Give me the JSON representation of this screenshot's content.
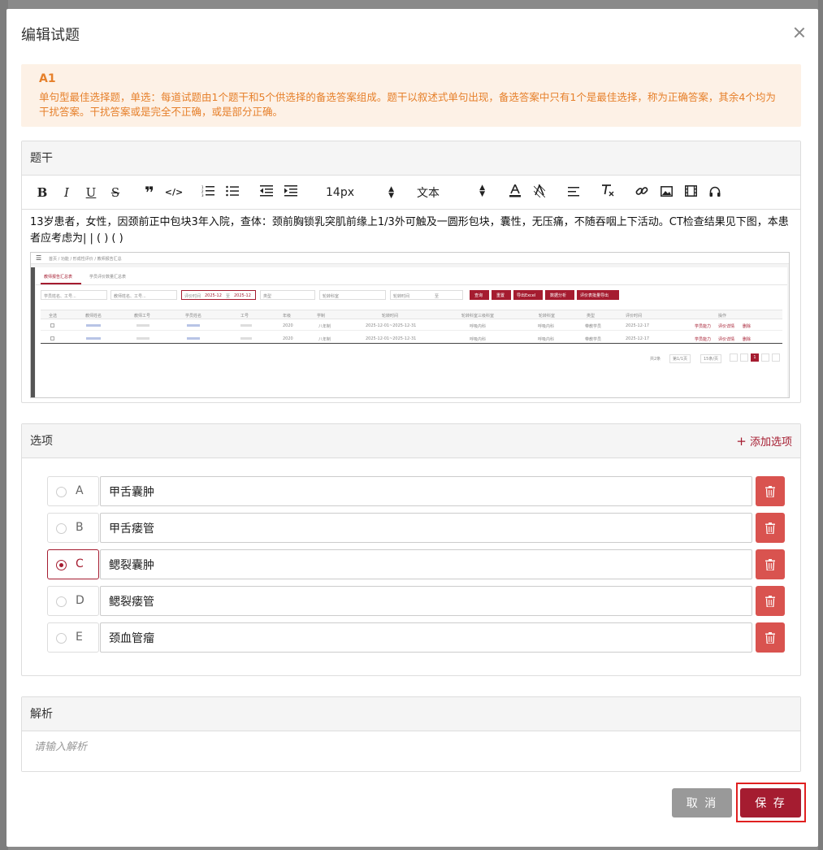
{
  "modal": {
    "title": "编辑试题"
  },
  "alert": {
    "title": "A1",
    "text": "单句型最佳选择题，单选：每道试题由1个题干和5个供选择的备选答案组成。题干以叙述式单句出现，备选答案中只有1个是最佳选择，称为正确答案，其余4个均为干扰答案。干扰答案或是完全不正确，或是部分正确。"
  },
  "stem": {
    "header": "题干",
    "toolbar": {
      "font_size": "14px",
      "block_type": "文本"
    },
    "text": "13岁患者，女性，因颈前正中包块3年入院，查体：颈前胸锁乳突肌前缘上1/3外可触及一圆形包块，囊性，无压痛，不随吞咽上下活动。CT检查结果见下图，本患者应考虑为| | ( ) ( )",
    "screenshot": {
      "breadcrumb": "首页 / 功能 / 形成性评价 / 教师报告汇总",
      "tabs": [
        "教师报告汇总表",
        "学员评价数量汇总表"
      ],
      "filters": [
        "学员姓名、工号...",
        "教师姓名、工号...",
        "评价时间",
        "2025-12",
        "至",
        "2025-12",
        "类型",
        "轮转科室",
        "轮转时间",
        "至"
      ],
      "buttons": [
        "查询",
        "重置",
        "导出Excel",
        "数据分析",
        "评价表批量导出"
      ],
      "columns": [
        "全选",
        "教师姓名",
        "教师工号",
        "学员姓名",
        "工号",
        "年级",
        "学制",
        "轮转时间",
        "轮转科室三级科室",
        "轮转科室",
        "类型",
        "评价时间",
        "操作"
      ],
      "rows": [
        [
          "2020",
          "八年制",
          "2025-12-01~2025-12-31",
          "呼吸内科",
          "呼吸内科",
          "带教学员",
          "2025-12-17"
        ],
        [
          "2020",
          "八年制",
          "2025-12-01~2025-12-31",
          "呼吸内科",
          "呼吸内科",
          "带教学员",
          "2025-12-17"
        ]
      ],
      "row_actions": [
        "学员能力",
        "评价详情",
        "删除"
      ],
      "pagination": {
        "total": "共2条",
        "page": "第1/1页",
        "per_page": "15条/页",
        "current": "1"
      }
    }
  },
  "options": {
    "header": "选项",
    "add_label": "添加选项",
    "items": [
      {
        "letter": "A",
        "text": "甲舌囊肿",
        "selected": false
      },
      {
        "letter": "B",
        "text": "甲舌瘘管",
        "selected": false
      },
      {
        "letter": "C",
        "text": "鳃裂囊肿",
        "selected": true
      },
      {
        "letter": "D",
        "text": "鳃裂瘘管",
        "selected": false
      },
      {
        "letter": "E",
        "text": "颈血管瘤",
        "selected": false
      }
    ]
  },
  "analysis": {
    "header": "解析",
    "placeholder": "请输入解析"
  },
  "footer": {
    "cancel": "取 消",
    "save": "保 存"
  },
  "colors": {
    "brand": "#a51c30",
    "danger": "#d9534f",
    "alert_text": "#e6802b",
    "alert_bg": "#fdf1e6"
  }
}
